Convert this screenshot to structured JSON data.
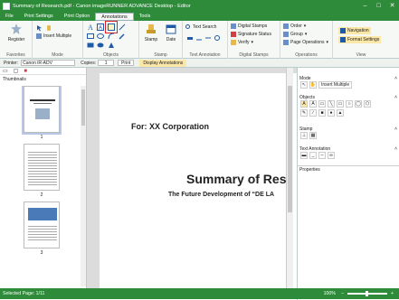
{
  "window": {
    "title": "Summary of Research.pdf - Canon imageRUNNER ADVANCE Desktop - Editor",
    "minimize": "–",
    "maximize": "□",
    "close": "✕"
  },
  "tabs": [
    {
      "label": "File"
    },
    {
      "label": "Print Settings"
    },
    {
      "label": "Print Option"
    },
    {
      "label": "Annotations"
    },
    {
      "label": "Tools"
    }
  ],
  "ribbon_right": {
    "info": "i",
    "help": "?"
  },
  "ribbon": {
    "favorites": {
      "register": "Register",
      "label": "Favorites"
    },
    "mode": {
      "insert_multiple": "Insert Multiple",
      "label": "Mode"
    },
    "objects": {
      "label": "Objects"
    },
    "stamp": {
      "stamp": "Stamp",
      "date": "Date",
      "label": "Stamp"
    },
    "text_annotation": {
      "text_search": "Text Search",
      "label": "Text Annotation"
    },
    "digital_stamps": {
      "digital_stamps": "Digital Stamps",
      "signature_status": "Signature Status",
      "verify": "Verify",
      "label": "Digital Stamps"
    },
    "operations": {
      "order": "Order",
      "group": "Group",
      "page_operations": "Page Operations",
      "label": "Operations"
    },
    "view": {
      "navigation": "Navigation",
      "format_settings": "Format Settings",
      "label": "View"
    }
  },
  "toolbar2": {
    "printer_label": "Printer:",
    "printer_value": "Canon iR-ADV",
    "copies_label": "Copies:",
    "copies_value": "1",
    "print": "Print",
    "display_annotations": "Display Annotations"
  },
  "left_panel": {
    "title": "Thumbnails",
    "pages": [
      {
        "num": "1"
      },
      {
        "num": "2"
      },
      {
        "num": "3"
      }
    ]
  },
  "document": {
    "line1": "For: XX Corporation",
    "line2": "Summary of Res",
    "line3": "The Future Development of “DE LA"
  },
  "right_panel": {
    "mode": "Mode",
    "insert_multiple": "Insert Multiple",
    "objects": "Objects",
    "stamp": "Stamp",
    "text_annotation": "Text Annotation",
    "properties": "Properties"
  },
  "status": {
    "selected_page": "Selected Page: 1/11",
    "zoom": "100%"
  },
  "colors": {
    "accent": "#2e8b3a",
    "highlight": "#e02020"
  }
}
